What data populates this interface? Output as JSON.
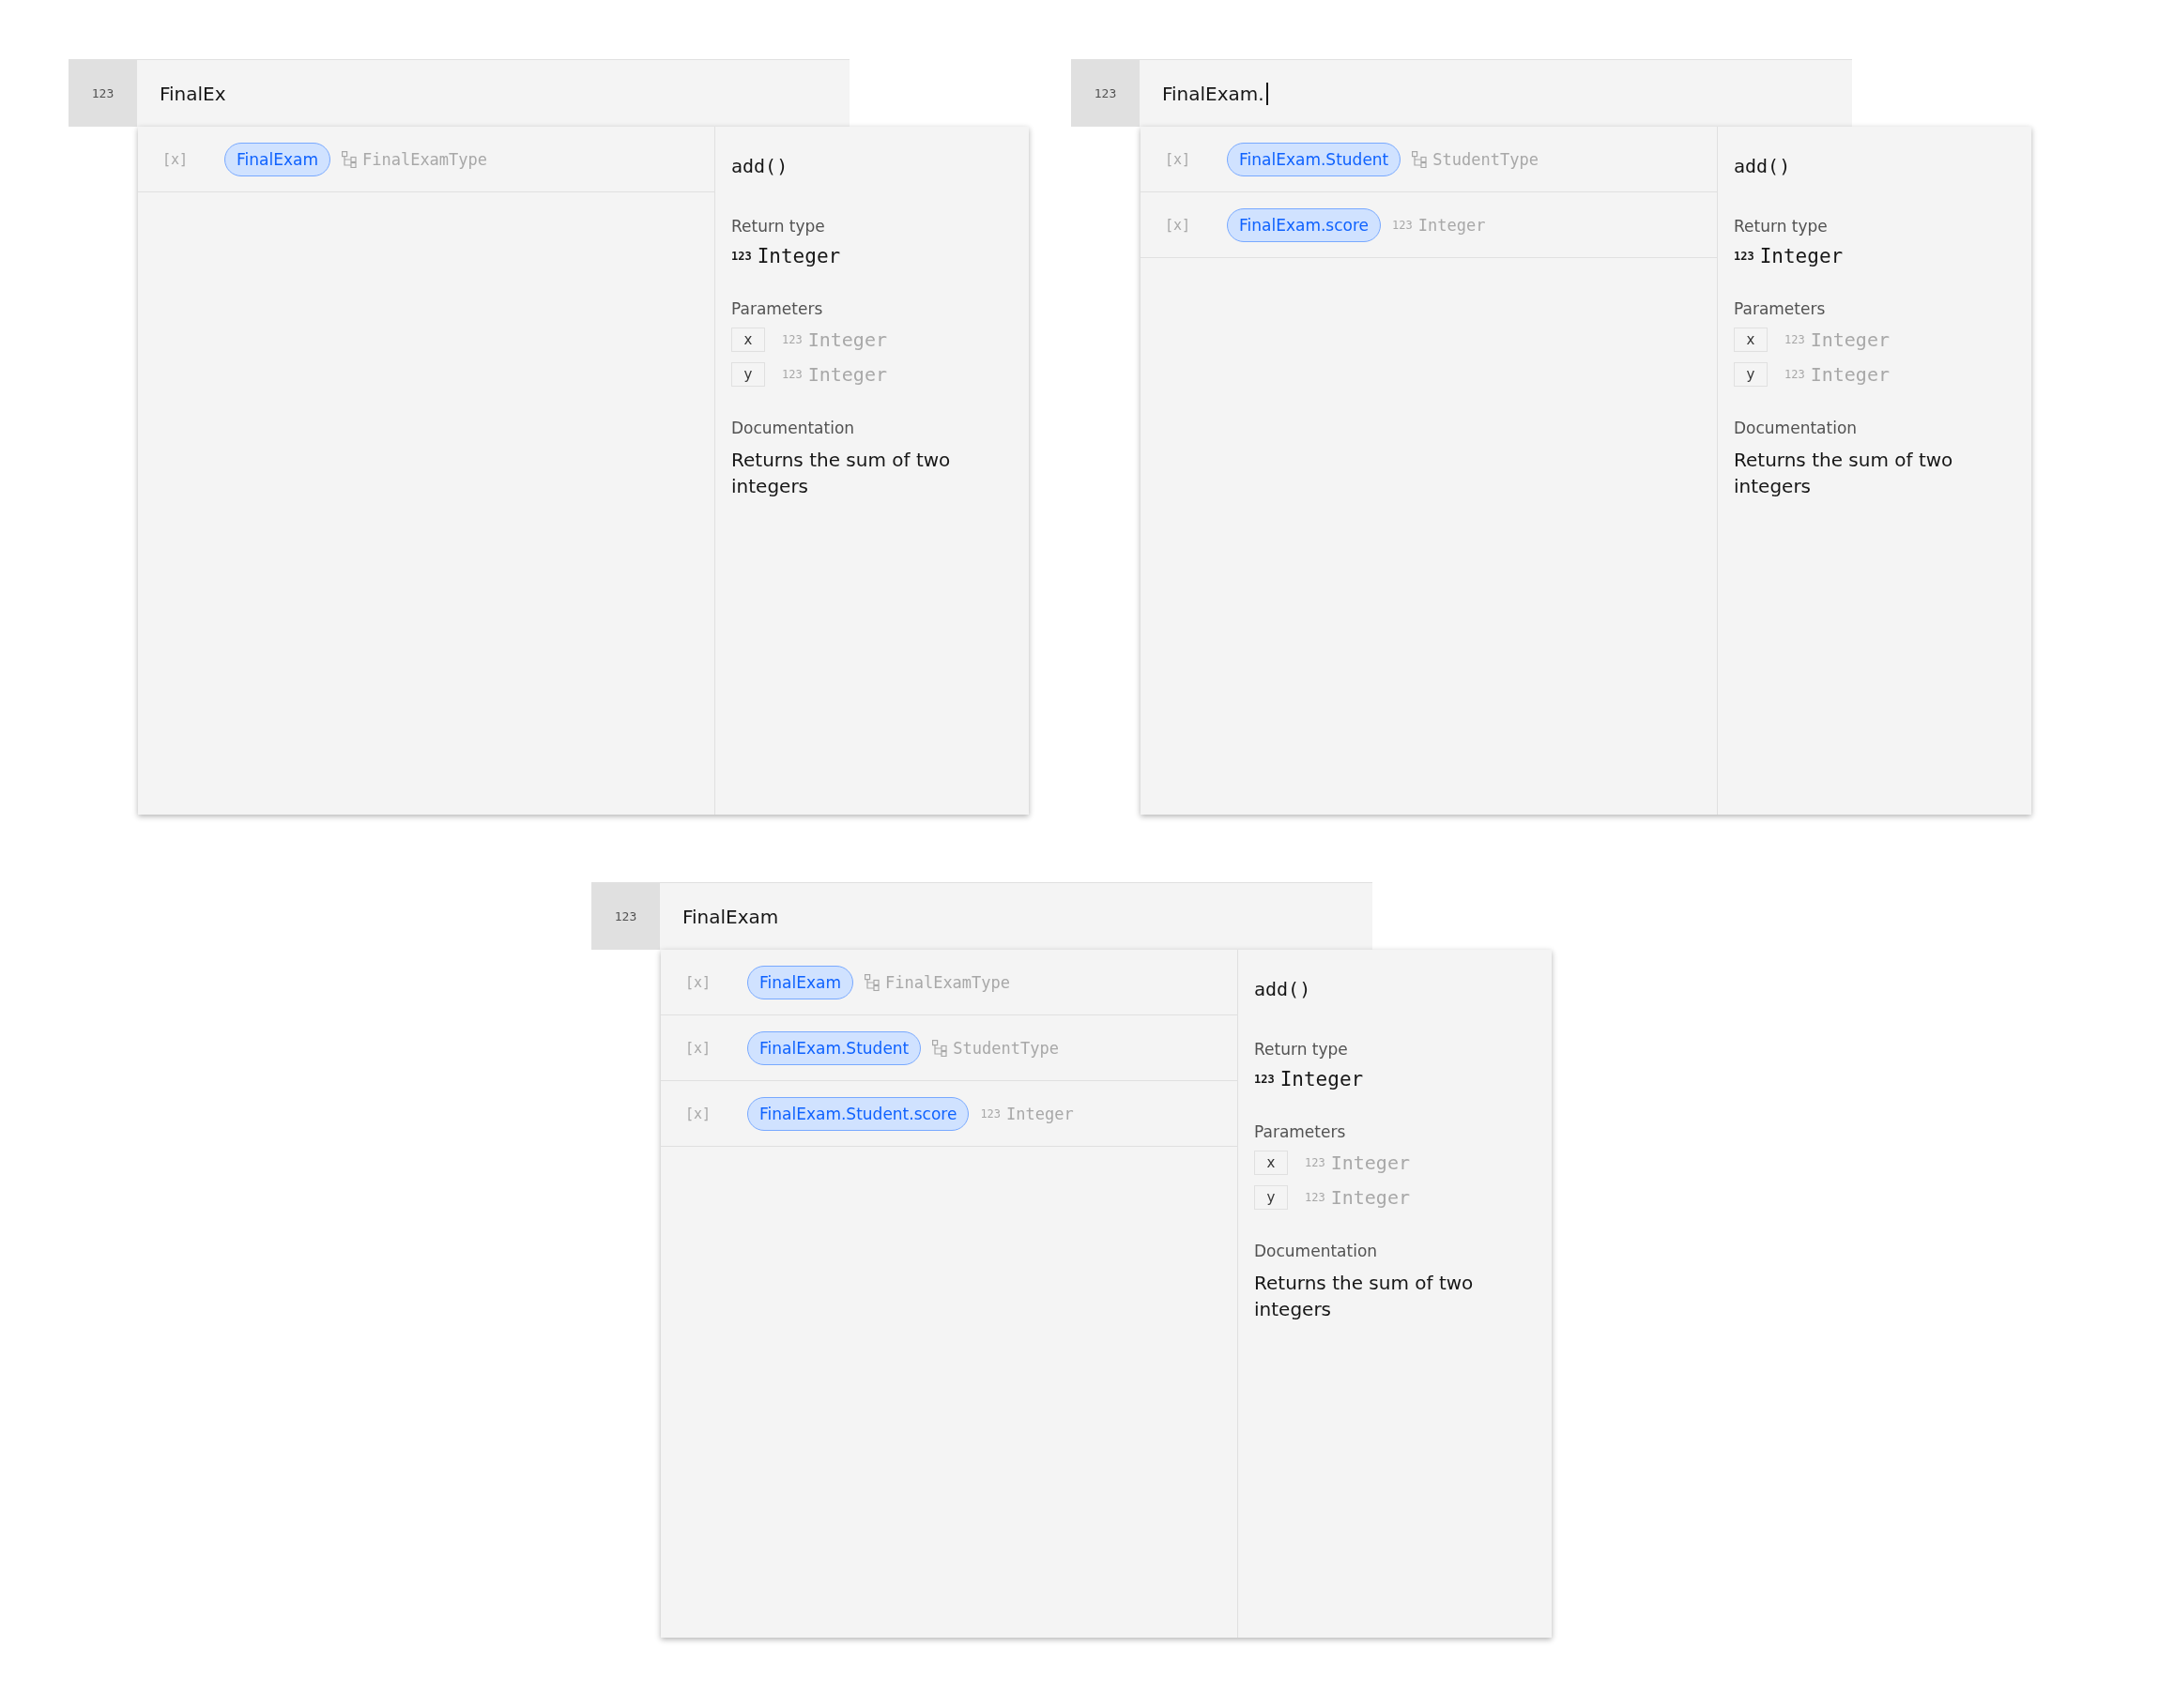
{
  "panels": [
    {
      "input": {
        "icon": "123",
        "value": "FinalEx",
        "cursor": false
      },
      "suggestions": [
        {
          "var_icon": "[x]",
          "name": "FinalExam",
          "kind": "tree",
          "type": "FinalExamType"
        }
      ],
      "detail": {
        "signature": "add()",
        "return_label": "Return type",
        "return_glyph": "123",
        "return_type": "Integer",
        "params_label": "Parameters",
        "params": [
          {
            "name": "x",
            "glyph": "123",
            "type": "Integer"
          },
          {
            "name": "y",
            "glyph": "123",
            "type": "Integer"
          }
        ],
        "doc_label": "Documentation",
        "doc": "Returns the sum of two integers"
      }
    },
    {
      "input": {
        "icon": "123",
        "value": "FinalExam.",
        "cursor": true
      },
      "suggestions": [
        {
          "var_icon": "[x]",
          "name": "FinalExam.Student",
          "kind": "tree",
          "type": "StudentType"
        },
        {
          "var_icon": "[x]",
          "name": "FinalExam.score",
          "kind": "number",
          "type_glyph": "123",
          "type": "Integer"
        }
      ],
      "detail": {
        "signature": "add()",
        "return_label": "Return type",
        "return_glyph": "123",
        "return_type": "Integer",
        "params_label": "Parameters",
        "params": [
          {
            "name": "x",
            "glyph": "123",
            "type": "Integer"
          },
          {
            "name": "y",
            "glyph": "123",
            "type": "Integer"
          }
        ],
        "doc_label": "Documentation",
        "doc": "Returns the sum of two integers"
      }
    },
    {
      "input": {
        "icon": "123",
        "value": "FinalExam",
        "cursor": false
      },
      "suggestions": [
        {
          "var_icon": "[x]",
          "name": "FinalExam",
          "kind": "tree",
          "type": "FinalExamType"
        },
        {
          "var_icon": "[x]",
          "name": "FinalExam.Student",
          "kind": "tree",
          "type": "StudentType"
        },
        {
          "var_icon": "[x]",
          "name": "FinalExam.Student.score",
          "kind": "number",
          "type_glyph": "123",
          "type": "Integer"
        }
      ],
      "detail": {
        "signature": "add()",
        "return_label": "Return type",
        "return_glyph": "123",
        "return_type": "Integer",
        "params_label": "Parameters",
        "params": [
          {
            "name": "x",
            "glyph": "123",
            "type": "Integer"
          },
          {
            "name": "y",
            "glyph": "123",
            "type": "Integer"
          }
        ],
        "doc_label": "Documentation",
        "doc": "Returns the sum of two integers"
      }
    }
  ]
}
